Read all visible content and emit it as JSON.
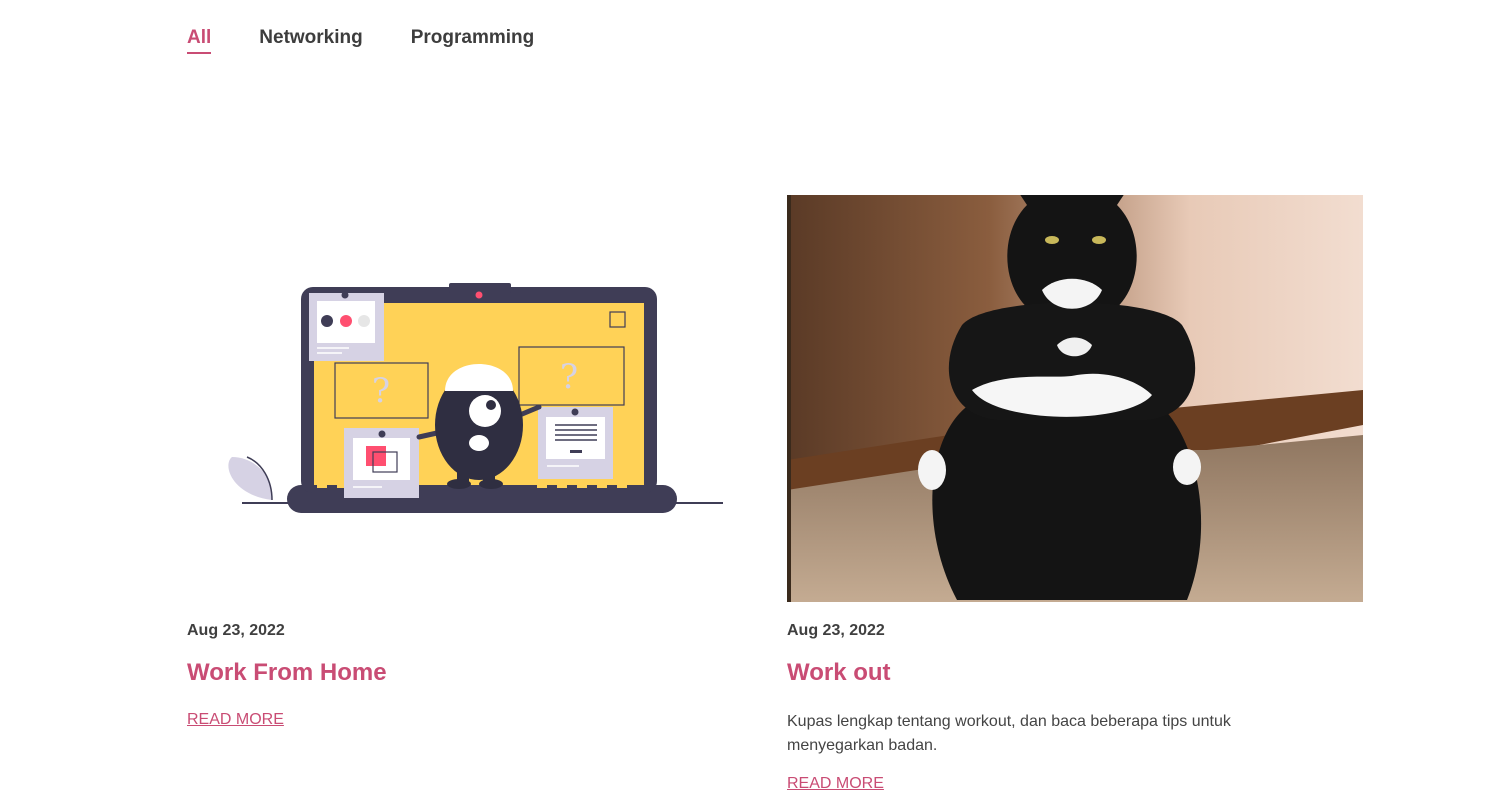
{
  "tabs": [
    {
      "label": "All",
      "active": true
    },
    {
      "label": "Networking",
      "active": false
    },
    {
      "label": "Programming",
      "active": false
    }
  ],
  "posts": [
    {
      "date": "Aug 23, 2022",
      "title": "Work From Home",
      "excerpt": "",
      "read_more": "READ MORE",
      "image": "work-from-home-illustration"
    },
    {
      "date": "Aug 23, 2022",
      "title": "Work out",
      "excerpt": "Kupas lengkap tentang workout, dan baca beberapa tips untuk menyegarkan badan.",
      "read_more": "READ MORE",
      "image": "black-white-cat-photo"
    }
  ],
  "colors": {
    "accent": "#c94c74",
    "text": "#3d3d3d",
    "illustration_yellow": "#ffd257",
    "illustration_dark": "#3f3d56"
  }
}
